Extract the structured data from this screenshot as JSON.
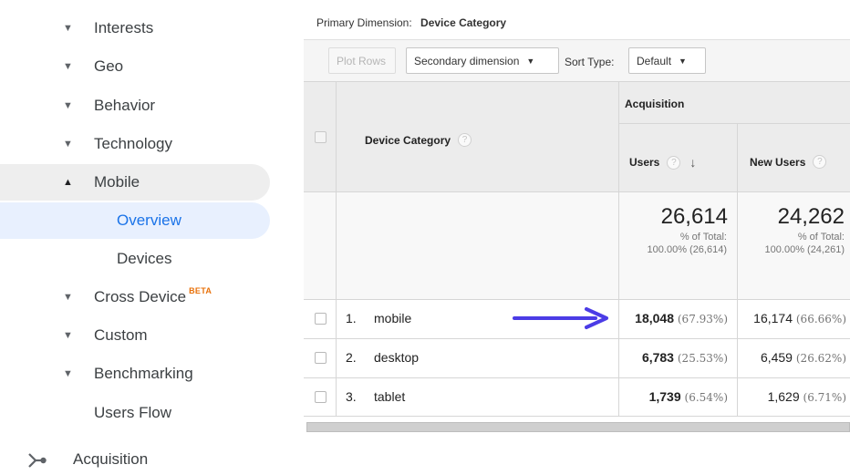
{
  "sidebar": {
    "items": [
      {
        "caret": "▼",
        "label": "Interests"
      },
      {
        "caret": "▼",
        "label": "Geo"
      },
      {
        "caret": "▼",
        "label": "Behavior"
      },
      {
        "caret": "▼",
        "label": "Technology"
      },
      {
        "caret": "▲",
        "label": "Mobile"
      },
      {
        "label": "Overview"
      },
      {
        "label": "Devices"
      },
      {
        "caret": "▼",
        "label": "Cross Device",
        "badge": "BETA"
      },
      {
        "caret": "▼",
        "label": "Custom"
      },
      {
        "caret": "▼",
        "label": "Benchmarking"
      },
      {
        "label": "Users Flow"
      }
    ],
    "section": {
      "icon": "acquisition-icon",
      "label": "Acquisition"
    }
  },
  "report": {
    "primary_dimension_label": "Primary Dimension:",
    "primary_dimension_value": "Device Category",
    "toolbar": {
      "plot_rows": "Plot Rows",
      "secondary_dimension": "Secondary dimension",
      "sort_type_label": "Sort Type:",
      "sort_type_value": "Default"
    },
    "table": {
      "group_header": "Acquisition",
      "dimension_header": "Device Category",
      "columns": [
        {
          "label": "Users",
          "help": "?",
          "sort": "↓"
        },
        {
          "label": "New Users",
          "help": "?"
        }
      ],
      "totals": [
        {
          "value": "26,614",
          "pct_label": "% of Total:",
          "pct_detail": "100.00% (26,614)"
        },
        {
          "value": "24,262",
          "pct_label": "% of Total:",
          "pct_detail": "100.00% (24,261)"
        }
      ],
      "rows": [
        {
          "num": "1.",
          "name": "mobile",
          "users": "18,048",
          "users_pct": "(67.93%)",
          "new_users": "16,174",
          "new_users_pct": "(66.66%)"
        },
        {
          "num": "2.",
          "name": "desktop",
          "users": "6,783",
          "users_pct": "(25.53%)",
          "new_users": "6,459",
          "new_users_pct": "(26.62%)"
        },
        {
          "num": "3.",
          "name": "tablet",
          "users": "1,739",
          "users_pct": "(6.54%)",
          "new_users": "1,629",
          "new_users_pct": "(6.71%)"
        }
      ]
    }
  },
  "colors": {
    "accent": "#1a73e8",
    "annotation_arrow": "#4b3ce6",
    "beta_badge": "#e8710a"
  }
}
